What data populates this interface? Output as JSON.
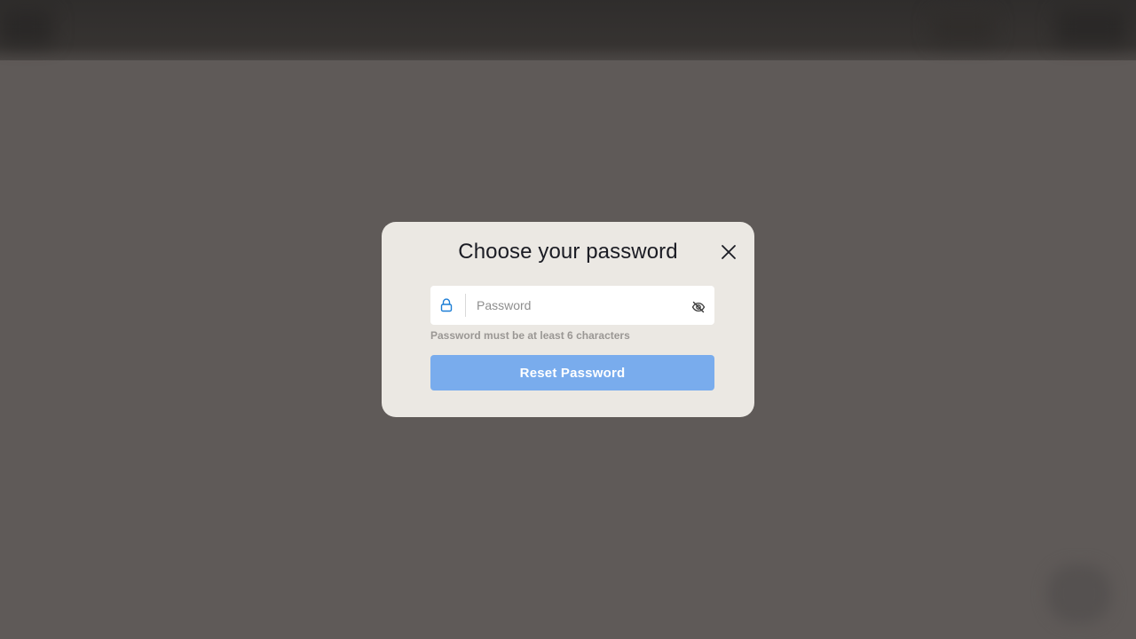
{
  "modal": {
    "title": "Choose your password",
    "close_icon": "close-icon",
    "password_field": {
      "placeholder": "Password",
      "value": "",
      "leading_icon": "lock-icon",
      "trailing_icon": "eye-off-icon"
    },
    "hint": "Password must be at least 6 characters",
    "submit_label": "Reset Password"
  },
  "colors": {
    "backdrop": "#5f5a58",
    "modal_bg": "#ebe8e3",
    "accent": "#1c7ed6",
    "button_disabled": "#79aced",
    "title": "#1b1c24",
    "hint": "#9a9794"
  }
}
